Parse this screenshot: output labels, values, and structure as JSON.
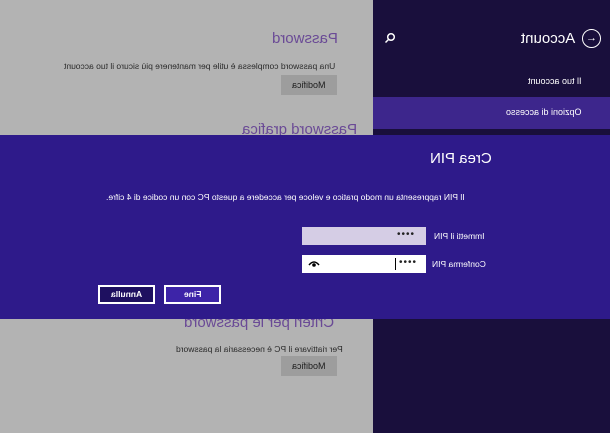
{
  "content": {
    "password": {
      "title": "Password",
      "desc": "Una password complessa è utile per mantenere più sicuro il tuo account",
      "button": "Modifica"
    },
    "picture_password": {
      "title": "Password grafica"
    },
    "sign_in": {
      "title": "Criteri per le password",
      "desc": "Per riattivare il PC è necessaria la password",
      "button": "Modifica"
    }
  },
  "pane": {
    "title": "Account",
    "items": [
      {
        "label": "Il tuo account"
      },
      {
        "label": "Opzioni di accesso"
      }
    ]
  },
  "dialog": {
    "title": "Crea PIN",
    "desc": "Il PIN rappresenta un modo pratico e veloce per accedere a questo PC con un codice di 4 cifre.",
    "pin_label": "Immetti il PIN",
    "pin_value": "••••",
    "confirm_label": "Conferma PIN",
    "confirm_value": "••••",
    "ok": "Fine",
    "cancel": "Annulla"
  },
  "colors": {
    "accent": "#2e1a8a",
    "pane_bg": "#190f3c",
    "pane_active": "#3d268c",
    "heading": "#6a4a96"
  }
}
